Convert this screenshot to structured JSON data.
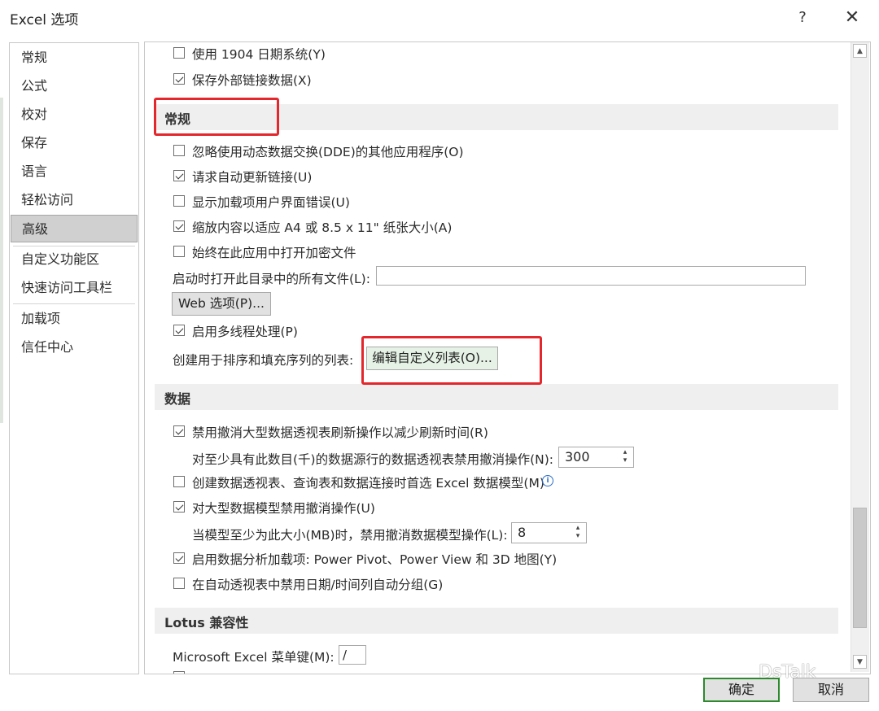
{
  "dialog": {
    "title": "Excel 选项",
    "help_label": "?",
    "close_label": "✕"
  },
  "nav": {
    "items": [
      {
        "label": "常规"
      },
      {
        "label": "公式"
      },
      {
        "label": "校对"
      },
      {
        "label": "保存"
      },
      {
        "label": "语言"
      },
      {
        "label": "轻松访问"
      },
      {
        "label": "高级",
        "selected": true
      },
      {
        "label": "自定义功能区"
      },
      {
        "label": "快速访问工具栏"
      },
      {
        "label": "加载项"
      },
      {
        "label": "信任中心"
      }
    ]
  },
  "content": {
    "top": {
      "date1904": {
        "label": "使用 1904 日期系统(Y)",
        "checked": false
      },
      "save_links": {
        "label": "保存外部链接数据(X)",
        "checked": true
      }
    },
    "general": {
      "header": "常规",
      "ignore_dde": {
        "label": "忽略使用动态数据交换(DDE)的其他应用程序(O)",
        "checked": false
      },
      "auto_update": {
        "label": "请求自动更新链接(U)",
        "checked": true
      },
      "show_addin_errors": {
        "label": "显示加载项用户界面错误(U)",
        "checked": false
      },
      "scale_a4": {
        "label": "缩放内容以适应 A4 或 8.5 x 11\" 纸张大小(A)",
        "checked": true
      },
      "open_encrypted": {
        "label": "始终在此应用中打开加密文件",
        "checked": false
      },
      "startup_folder_label": "启动时打开此目录中的所有文件(L):",
      "startup_folder_value": "",
      "web_options_button": "Web 选项(P)...",
      "multithread": {
        "label": "启用多线程处理(P)",
        "checked": true
      },
      "custom_lists_label": "创建用于排序和填充序列的列表:",
      "custom_lists_button": "编辑自定义列表(O)..."
    },
    "data": {
      "header": "数据",
      "disable_undo_pivot": {
        "label": "禁用撤消大型数据透视表刷新操作以减少刷新时间(R)",
        "checked": true
      },
      "pivot_rows_label": "对至少具有此数目(千)的数据源行的数据透视表禁用撤消操作(N):",
      "pivot_rows_value": "300",
      "prefer_data_model": {
        "label": "创建数据透视表、查询表和数据连接时首选 Excel 数据模型(M)",
        "checked": false
      },
      "info_icon": "i",
      "disable_undo_model": {
        "label": "对大型数据模型禁用撤消操作(U)",
        "checked": true
      },
      "model_size_label": "当模型至少为此大小(MB)时，禁用撤消数据模型操作(L):",
      "model_size_value": "8",
      "enable_addins": {
        "label": "启用数据分析加载项: Power Pivot、Power View 和 3D 地图(Y)",
        "checked": true
      },
      "disable_date_group": {
        "label": "在自动透视表中禁用日期/时间列自动分组(G)",
        "checked": false
      }
    },
    "lotus": {
      "header": "Lotus 兼容性",
      "menu_key_label": "Microsoft Excel 菜单键(M):",
      "menu_key_value": "/"
    }
  },
  "footer": {
    "ok_label": "确定",
    "cancel_label": "取消"
  },
  "watermark": "DsTalk",
  "colors": {
    "highlight": "#e3272d",
    "selected_nav": "#d0d0d0",
    "section_bg": "#efefef",
    "primary_border": "#2c8a2c",
    "custom_list_button": "#e6f2e6"
  },
  "icons": {
    "help": "question-mark-icon",
    "close": "close-icon",
    "checkbox": "checkmark-icon",
    "spinner": "up-down-arrows-icon",
    "info": "info-icon",
    "scroll_up": "chevron-up-icon",
    "scroll_down": "chevron-down-icon"
  }
}
